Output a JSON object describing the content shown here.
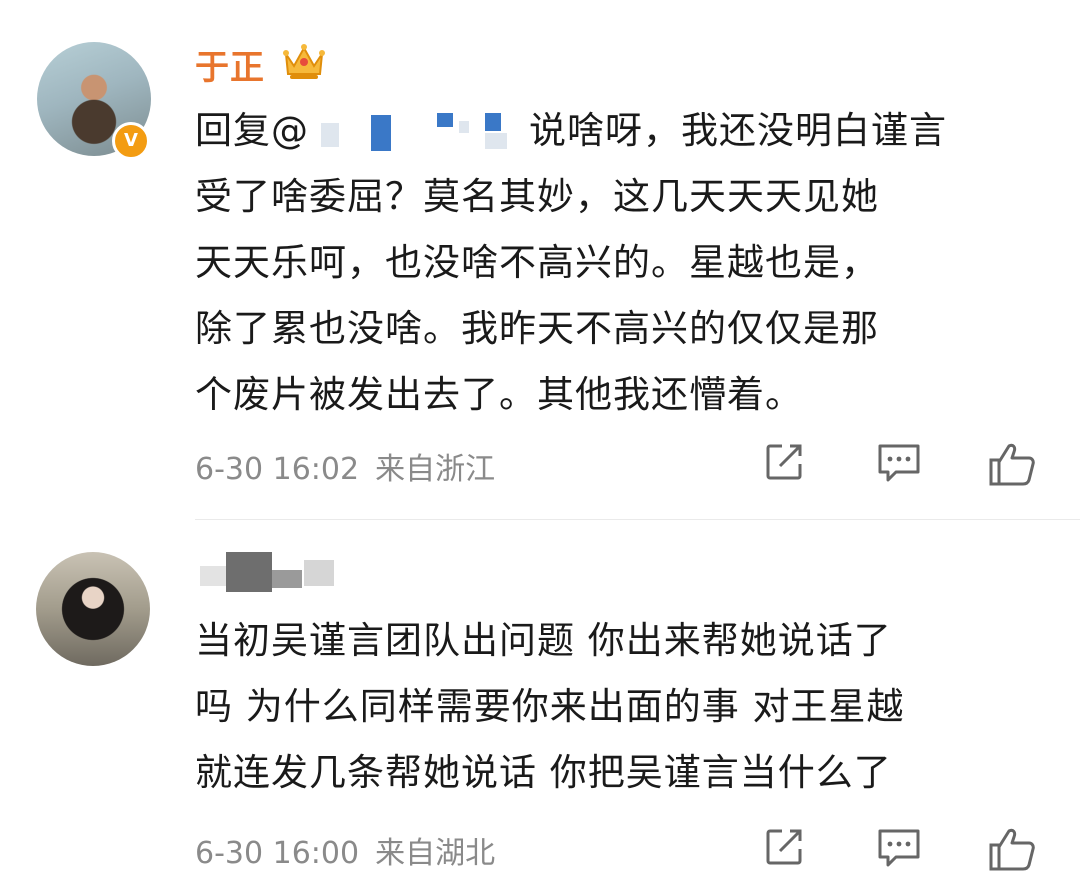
{
  "comments": [
    {
      "username": "于正",
      "verified_badge": "V",
      "text_prefix": "回复@",
      "text_lines": [
        "说啥呀，我还没明白谨言",
        "受了啥委屈？莫名其妙，这几天天天见她",
        "天天乐呵，也没啥不高兴的。星越也是，",
        "除了累也没啥。我昨天不高兴的仅仅是那",
        "个废片被发出去了。其他我还懵着。"
      ],
      "time": "6-30 16:02",
      "location": "来自浙江",
      "icons": {
        "crown": "crown-icon",
        "share": "share-icon",
        "reply": "comment-icon",
        "like": "thumbs-up-icon"
      }
    },
    {
      "text_lines": [
        "当初吴谨言团队出问题 你出来帮她说话了",
        "吗 为什么同样需要你来出面的事 对王星越",
        "就连发几条帮她说话 你把吴谨言当什么了"
      ],
      "time": "6-30 16:00",
      "location": "来自湖北"
    }
  ],
  "colors": {
    "username": "#e8752d",
    "meta": "#8a8a8a",
    "text": "#1a1a1a",
    "accent_blue": "#3a78c7"
  }
}
